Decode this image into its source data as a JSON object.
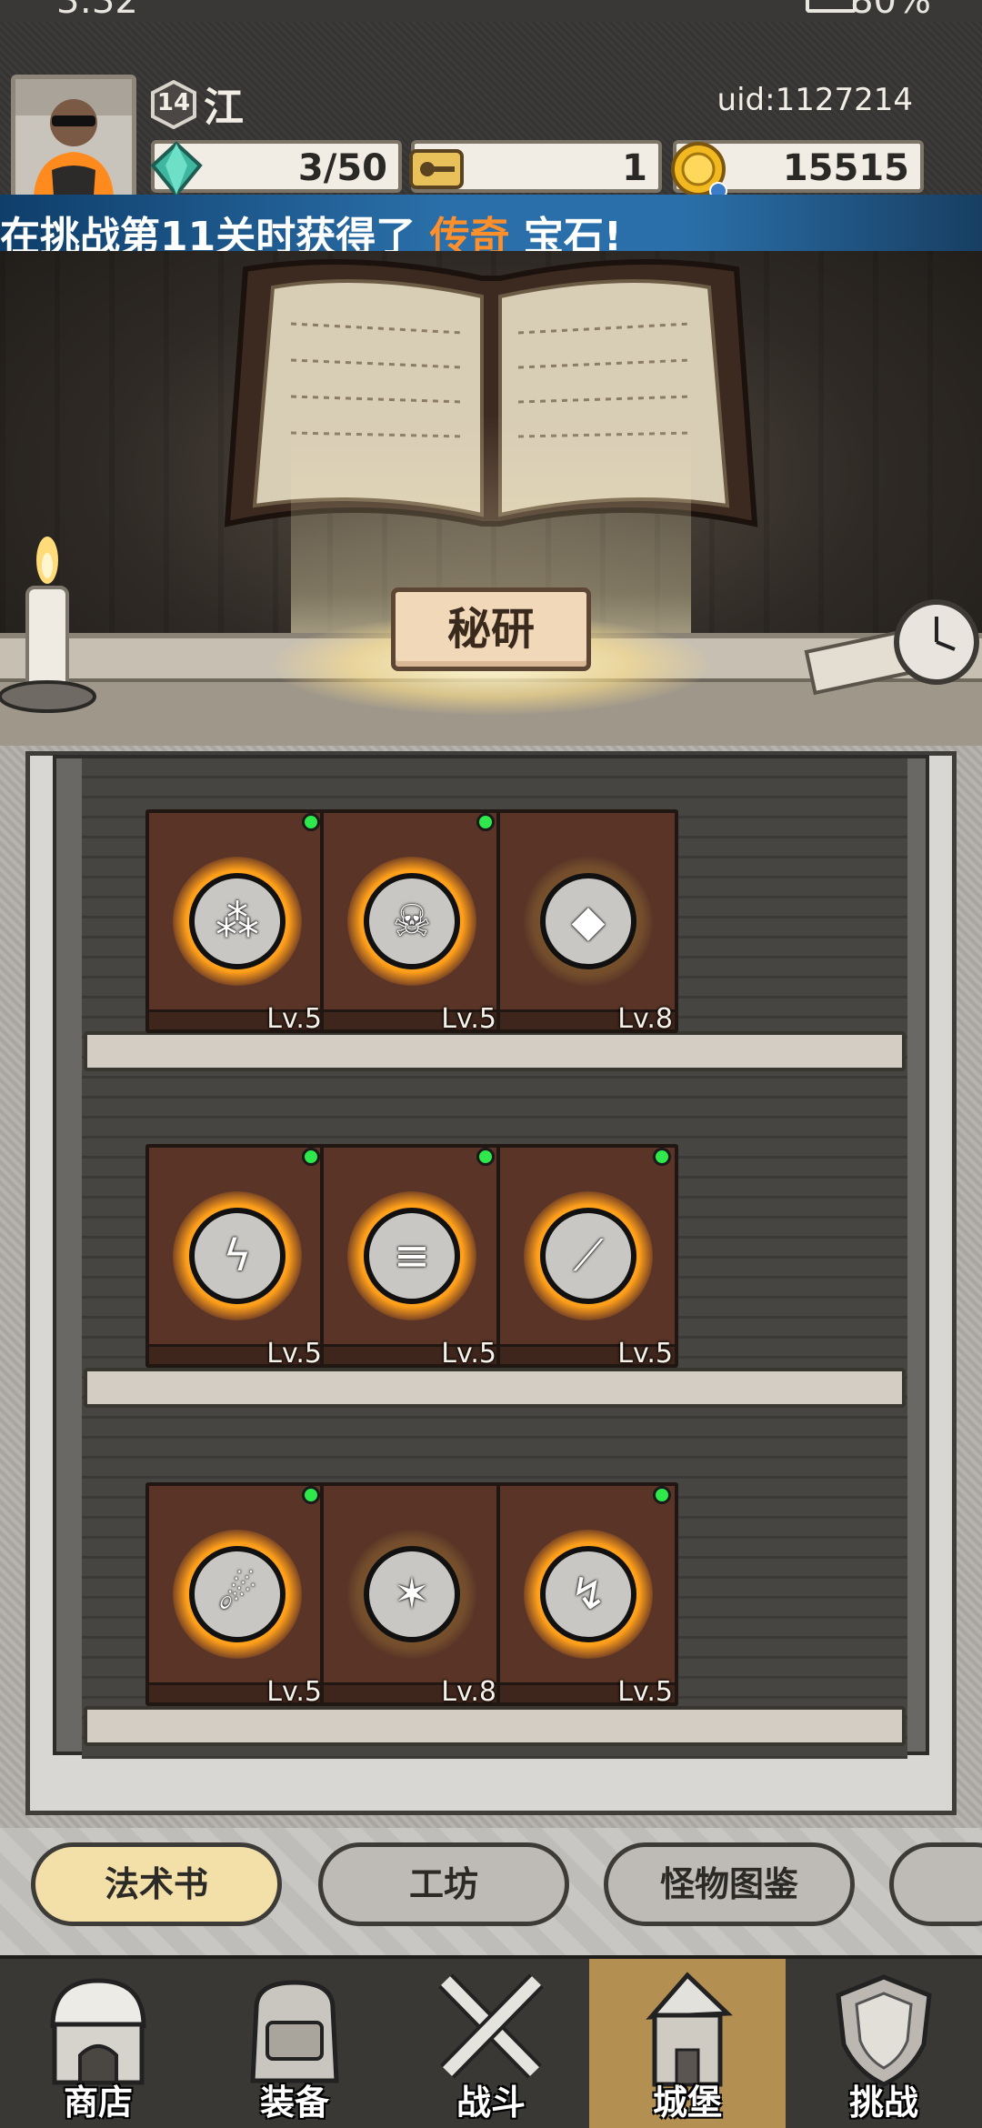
{
  "status_bar": {
    "time": "3:32",
    "battery": "80%"
  },
  "player": {
    "level": "14",
    "name": "江",
    "uid": "uid:1127214"
  },
  "resources": {
    "gems": "3/50",
    "keys": "1",
    "coins": "15515"
  },
  "announcement": {
    "prefix": "在挑战第11关时获得了 ",
    "highlight": "传奇",
    "suffix": " 宝石!"
  },
  "research_button": "秘研",
  "books": [
    {
      "level": "Lv.5",
      "icon": "seeds-icon",
      "glyph": "⁂",
      "has_update": true,
      "locked": false
    },
    {
      "level": "Lv.5",
      "icon": "skull-icon",
      "glyph": "☠",
      "has_update": true,
      "locked": false
    },
    {
      "level": "Lv.8",
      "icon": "crystal-block-icon",
      "glyph": "◆",
      "has_update": false,
      "locked": true
    },
    {
      "level": "Lv.5",
      "icon": "lightning-icon",
      "glyph": "ϟ",
      "has_update": true,
      "locked": false
    },
    {
      "level": "Lv.5",
      "icon": "ice-bar-icon",
      "glyph": "≡",
      "has_update": true,
      "locked": false
    },
    {
      "level": "Lv.5",
      "icon": "slash-icon",
      "glyph": "⟋",
      "has_update": true,
      "locked": false
    },
    {
      "level": "Lv.5",
      "icon": "meteor-icon",
      "glyph": "☄",
      "has_update": true,
      "locked": false
    },
    {
      "level": "Lv.8",
      "icon": "crystal-cluster-icon",
      "glyph": "✶",
      "has_update": false,
      "locked": true
    },
    {
      "level": "Lv.5",
      "icon": "chain-lightning-icon",
      "glyph": "↯",
      "has_update": true,
      "locked": false
    }
  ],
  "tabs": [
    {
      "label": "法术书",
      "active": true
    },
    {
      "label": "工坊",
      "active": false
    },
    {
      "label": "怪物图鉴",
      "active": false
    }
  ],
  "nav": [
    {
      "label": "商店",
      "icon": "shop-icon"
    },
    {
      "label": "装备",
      "icon": "backpack-icon"
    },
    {
      "label": "战斗",
      "icon": "crossed-swords-icon"
    },
    {
      "label": "城堡",
      "icon": "castle-icon",
      "active": true
    },
    {
      "label": "挑战",
      "icon": "shield-icon"
    }
  ]
}
